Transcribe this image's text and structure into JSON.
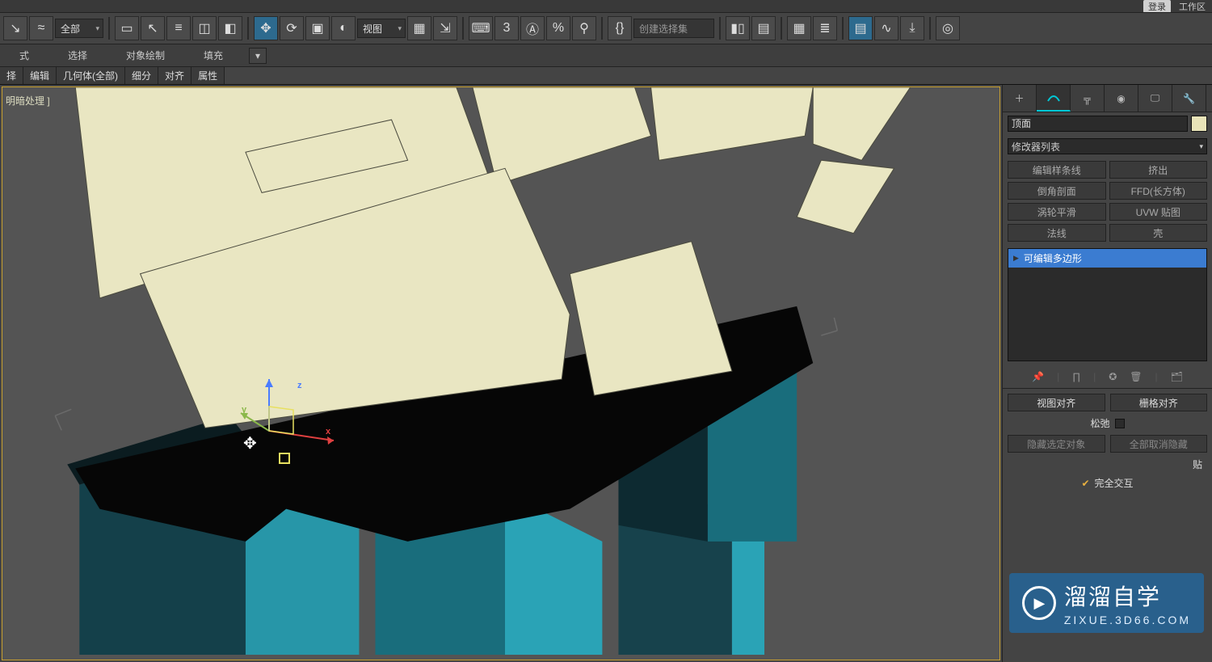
{
  "topbar": {
    "login": "登录",
    "workspace": "工作区"
  },
  "toolbar": {
    "dd_all": "全部",
    "dd_view": "视图",
    "sel_set_placeholder": "创建选择集",
    "num3": "3"
  },
  "ribbonRow": {
    "style": "式",
    "select": "选择",
    "objPaint": "对象绘制",
    "fill": "填充"
  },
  "ribbonTabs": [
    "择",
    "编辑",
    "几何体(全部)",
    "细分",
    "对齐",
    "属性"
  ],
  "viewport": {
    "label": "明暗处理 ]",
    "axes": {
      "x": "x",
      "y": "y",
      "z": "z"
    }
  },
  "panel": {
    "objName": "顶面",
    "modList": "修改器列表",
    "modButtons": [
      [
        "编辑样条线",
        "挤出"
      ],
      [
        "倒角剖面",
        "FFD(长方体)"
      ],
      [
        "涡轮平滑",
        "UVW 贴图"
      ],
      [
        "法线",
        "壳"
      ]
    ],
    "stackItem": "可编辑多边形",
    "align": {
      "viewAlign": "视图对齐",
      "gridAlign": "栅格对齐"
    },
    "relax": "松弛",
    "hide": {
      "hideSel": "隐藏选定对象",
      "unhideAll": "全部取消隐藏"
    },
    "paste": "贴",
    "fullIntersect": "完全交互"
  },
  "watermark": {
    "brand": "溜溜自学",
    "url": "ZIXUE.3D66.COM"
  }
}
